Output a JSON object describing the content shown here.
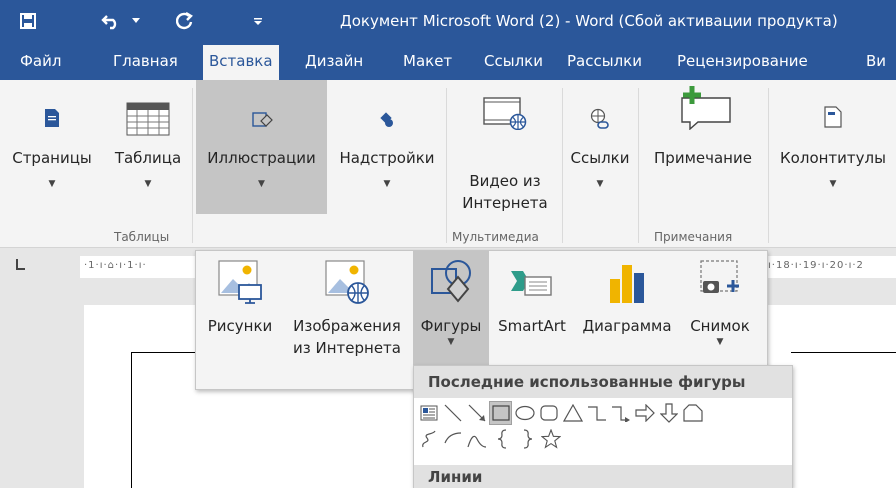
{
  "window": {
    "title": "Документ Microsoft Word (2) - Word (Сбой активации продукта)",
    "accent": "#2b579a"
  },
  "quick_access": [
    {
      "name": "save-icon",
      "glyph": "🖫"
    },
    {
      "name": "undo-icon",
      "glyph": "↶"
    },
    {
      "name": "undo-dropdown-icon",
      "glyph": "˅"
    },
    {
      "name": "redo-icon",
      "glyph": "↻"
    },
    {
      "name": "customize-qat-icon",
      "glyph": "="
    }
  ],
  "tabs": [
    "Файл",
    "Главная",
    "Вставка",
    "Дизайн",
    "Макет",
    "Ссылки",
    "Рассылки",
    "Рецензирование",
    "Ви"
  ],
  "active_tab": "Вставка",
  "ribbon": {
    "pages": {
      "label": "Страницы"
    },
    "table": {
      "label": "Таблица"
    },
    "illustrations": {
      "label": "Иллюстрации"
    },
    "addins": {
      "label": "Надстройки"
    },
    "video": {
      "label_line1": "Видео из",
      "label_line2": "Интернета"
    },
    "links": {
      "label": "Ссылки"
    },
    "comment": {
      "label": "Примечание"
    },
    "headers": {
      "label": "Колонтитулы"
    },
    "groups": {
      "tables": "Таблицы",
      "media": "Мультимедиа",
      "comments": "Примечания"
    }
  },
  "ruler": {
    "left_text": "·1·ı·⌂·ı·1·ı·",
    "right_text": "ı·18·ı·19·ı·20·ı·2"
  },
  "illustrations_menu": {
    "pictures": {
      "label": "Рисунки"
    },
    "online_pictures": {
      "label_line1": "Изображения",
      "label_line2": "из Интернета"
    },
    "shapes": {
      "label": "Фигуры"
    },
    "smartart": {
      "label": "SmartArt"
    },
    "chart": {
      "label": "Диаграмма"
    },
    "screenshot": {
      "label": "Снимок"
    }
  },
  "shapes_gallery": {
    "recent_header": "Последние использованные фигуры",
    "lines_header": "Линии",
    "row1": [
      "text-box",
      "line",
      "arrow-line",
      "rectangle",
      "oval",
      "rounded-rectangle",
      "triangle",
      "elbow-connector",
      "elbow-arrow-connector",
      "right-arrow",
      "down-arrow",
      "snip-rectangle"
    ],
    "row2": [
      "freeform",
      "arc",
      "curve",
      "left-brace",
      "right-brace",
      "star"
    ]
  }
}
